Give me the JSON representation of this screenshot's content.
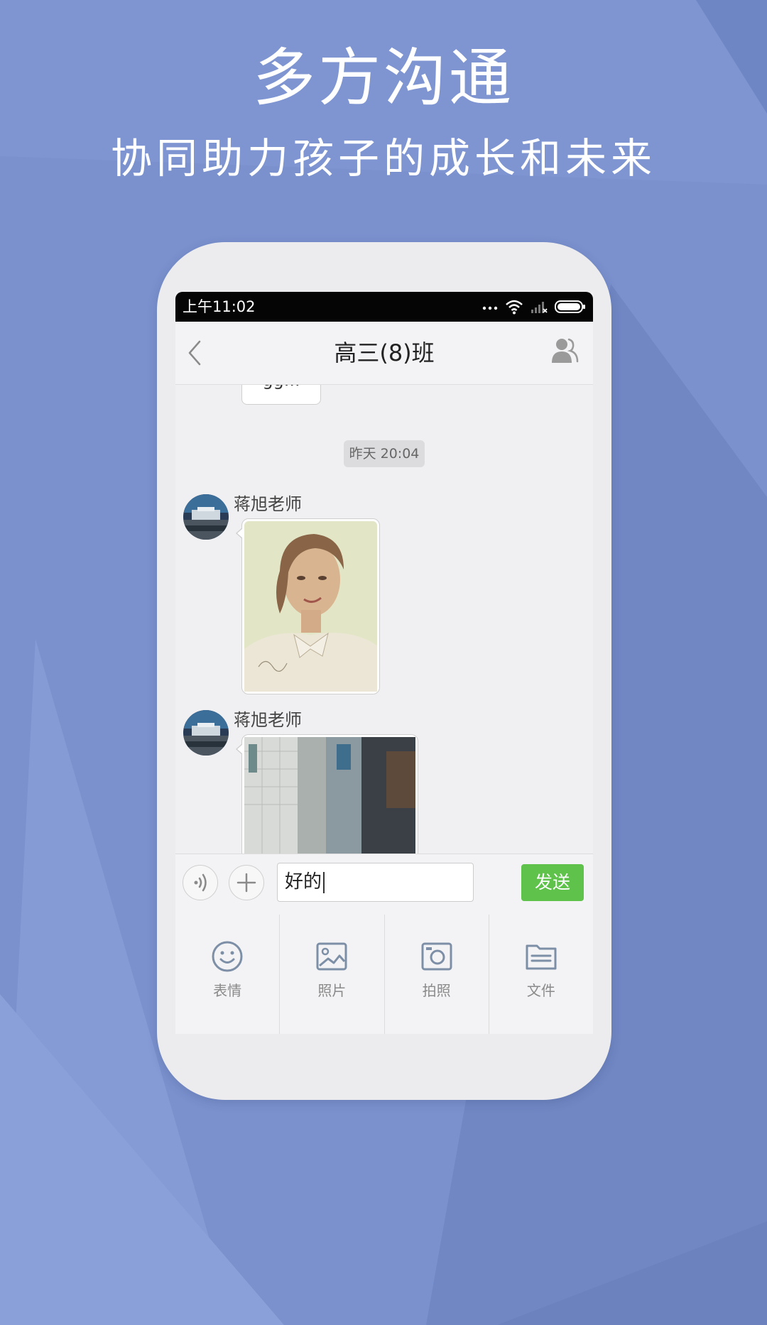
{
  "promo": {
    "title": "多方沟通",
    "subtitle": "协同助力孩子的成长和未来"
  },
  "status_bar": {
    "time": "上午11:02",
    "icons": [
      "more-dots-icon",
      "wifi-icon",
      "signal-icon",
      "battery-icon"
    ]
  },
  "header": {
    "back_icon": "back-chevron-icon",
    "title": "高三(8)班",
    "members_icon": "group-members-icon"
  },
  "chat": {
    "previous_message_partial": "gg...",
    "timestamp": "昨天  20:04",
    "messages": [
      {
        "sender": "蒋旭老师",
        "type": "image",
        "image": "portrait-painting"
      },
      {
        "sender": "蒋旭老师",
        "type": "image",
        "image": "hallway-photo"
      }
    ]
  },
  "composer": {
    "voice_icon": "voice-icon",
    "plus_icon": "plus-icon",
    "input_value": "好的",
    "send_label": "发送"
  },
  "toolbar": {
    "items": [
      {
        "label": "表情",
        "icon": "emoji-icon"
      },
      {
        "label": "照片",
        "icon": "photo-icon"
      },
      {
        "label": "拍照",
        "icon": "camera-icon"
      },
      {
        "label": "文件",
        "icon": "folder-icon"
      }
    ]
  },
  "colors": {
    "background": "#7b92cf",
    "send_button": "#5ec24b",
    "status_bar": "#050505"
  }
}
